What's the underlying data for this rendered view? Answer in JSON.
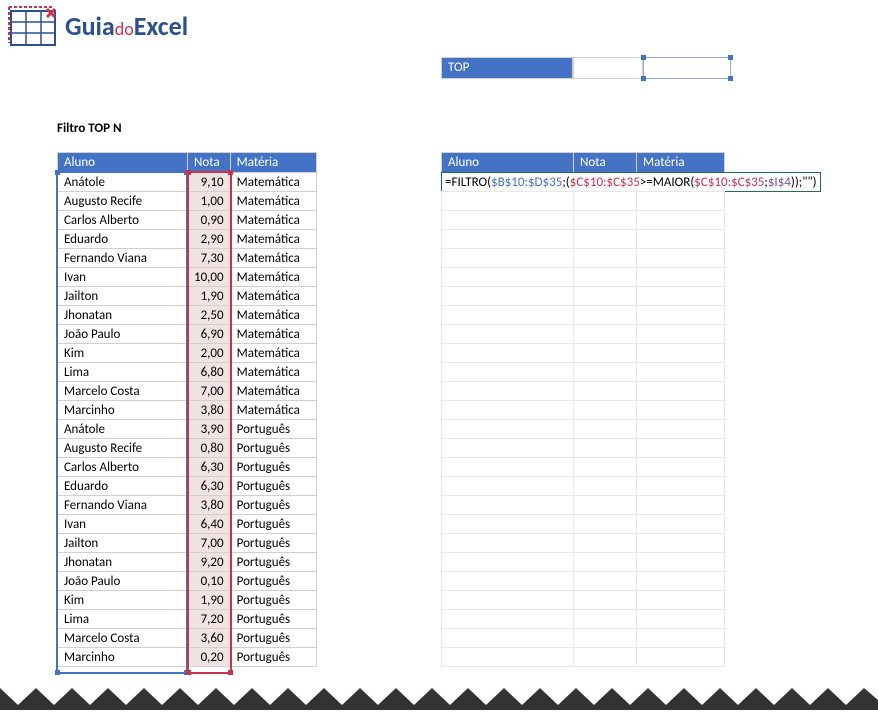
{
  "logo": {
    "text_guia": "Guia",
    "text_do": "do",
    "text_excel": "Excel"
  },
  "top": {
    "label": "TOP"
  },
  "title": "Filtro TOP N",
  "headers": {
    "aluno": "Aluno",
    "nota": "Nota",
    "materia": "Matéria"
  },
  "rows": [
    {
      "aluno": "Anátole",
      "nota": "9,10",
      "materia": "Matemática"
    },
    {
      "aluno": "Augusto Recife",
      "nota": "1,00",
      "materia": "Matemática"
    },
    {
      "aluno": "Carlos Alberto",
      "nota": "0,90",
      "materia": "Matemática"
    },
    {
      "aluno": "Eduardo",
      "nota": "2,90",
      "materia": "Matemática"
    },
    {
      "aluno": "Fernando Viana",
      "nota": "7,30",
      "materia": "Matemática"
    },
    {
      "aluno": "Ivan",
      "nota": "10,00",
      "materia": "Matemática"
    },
    {
      "aluno": "Jailton",
      "nota": "1,90",
      "materia": "Matemática"
    },
    {
      "aluno": "Jhonatan",
      "nota": "2,50",
      "materia": "Matemática"
    },
    {
      "aluno": "João Paulo",
      "nota": "6,90",
      "materia": "Matemática"
    },
    {
      "aluno": "Kim",
      "nota": "2,00",
      "materia": "Matemática"
    },
    {
      "aluno": "Lima",
      "nota": "6,80",
      "materia": "Matemática"
    },
    {
      "aluno": "Marcelo Costa",
      "nota": "7,00",
      "materia": "Matemática"
    },
    {
      "aluno": "Marcinho",
      "nota": "3,80",
      "materia": "Matemática"
    },
    {
      "aluno": "Anátole",
      "nota": "3,90",
      "materia": "Português"
    },
    {
      "aluno": "Augusto Recife",
      "nota": "0,80",
      "materia": "Português"
    },
    {
      "aluno": "Carlos Alberto",
      "nota": "6,30",
      "materia": "Português"
    },
    {
      "aluno": "Eduardo",
      "nota": "6,30",
      "materia": "Português"
    },
    {
      "aluno": "Fernando Viana",
      "nota": "3,80",
      "materia": "Português"
    },
    {
      "aluno": "Ivan",
      "nota": "6,40",
      "materia": "Português"
    },
    {
      "aluno": "Jailton",
      "nota": "7,00",
      "materia": "Português"
    },
    {
      "aluno": "Jhonatan",
      "nota": "9,20",
      "materia": "Português"
    },
    {
      "aluno": "João Paulo",
      "nota": "0,10",
      "materia": "Português"
    },
    {
      "aluno": "Kim",
      "nota": "1,90",
      "materia": "Português"
    },
    {
      "aluno": "Lima",
      "nota": "7,20",
      "materia": "Português"
    },
    {
      "aluno": "Marcelo Costa",
      "nota": "3,60",
      "materia": "Português"
    },
    {
      "aluno": "Marcinho",
      "nota": "0,20",
      "materia": "Português"
    }
  ],
  "formula": {
    "p0a": "=FILTRO(",
    "p1a": "$B$10:$D$35",
    "p0b": ";(",
    "p2a": "$C$10:$C$35",
    "p0c": ">=MAIOR(",
    "p2b": "$C$10:$C$35",
    "p0d": ";",
    "p3a": "$I$4",
    "p0e": "));\"\")"
  }
}
